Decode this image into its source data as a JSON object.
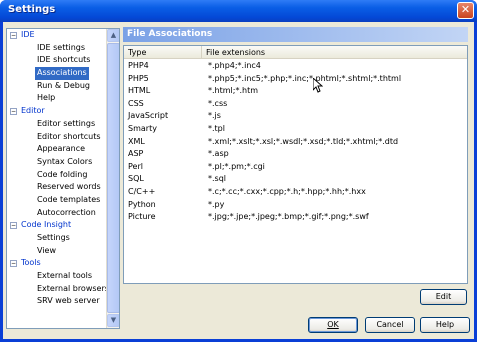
{
  "window": {
    "title": "Settings",
    "close_glyph": "✕"
  },
  "tree": {
    "rows": [
      {
        "kind": "cat",
        "label": "IDE",
        "expander": "−"
      },
      {
        "kind": "item",
        "label": "IDE settings"
      },
      {
        "kind": "item",
        "label": "IDE shortcuts"
      },
      {
        "kind": "item",
        "label": "Associations",
        "selected": true
      },
      {
        "kind": "item",
        "label": "Run & Debug"
      },
      {
        "kind": "item",
        "label": "Help"
      },
      {
        "kind": "cat",
        "label": "Editor",
        "expander": "−"
      },
      {
        "kind": "item",
        "label": "Editor settings"
      },
      {
        "kind": "item",
        "label": "Editor shortcuts"
      },
      {
        "kind": "item",
        "label": "Appearance"
      },
      {
        "kind": "item",
        "label": "Syntax Colors"
      },
      {
        "kind": "item",
        "label": "Code folding"
      },
      {
        "kind": "item",
        "label": "Reserved words"
      },
      {
        "kind": "item",
        "label": "Code templates"
      },
      {
        "kind": "item",
        "label": "Autocorrection"
      },
      {
        "kind": "cat",
        "label": "Code Insight",
        "expander": "−"
      },
      {
        "kind": "item",
        "label": "Settings"
      },
      {
        "kind": "item",
        "label": "View"
      },
      {
        "kind": "cat",
        "label": "Tools",
        "expander": "−"
      },
      {
        "kind": "item",
        "label": "External tools"
      },
      {
        "kind": "item",
        "label": "External browsers"
      },
      {
        "kind": "item",
        "label": "SRV web server"
      }
    ],
    "scroll_up_glyph": "▲",
    "scroll_down_glyph": "▼"
  },
  "panel": {
    "title": "File Associations",
    "columns": {
      "type": "Type",
      "ext": "File extensions"
    },
    "rows": [
      {
        "type": "PHP4",
        "ext": "*.php4;*.inc4"
      },
      {
        "type": "PHP5",
        "ext": "*.php5;*.inc5;*.php;*.inc;*.phtml;*.shtml;*.thtml"
      },
      {
        "type": "HTML",
        "ext": "*.html;*.htm"
      },
      {
        "type": "CSS",
        "ext": "*.css"
      },
      {
        "type": "JavaScript",
        "ext": "*.js"
      },
      {
        "type": "Smarty",
        "ext": "*.tpl"
      },
      {
        "type": "XML",
        "ext": "*.xml;*.xslt;*.xsl;*.wsdl;*.xsd;*.tld;*.xhtml;*.dtd"
      },
      {
        "type": "ASP",
        "ext": "*.asp"
      },
      {
        "type": "Perl",
        "ext": "*.pl;*.pm;*.cgi"
      },
      {
        "type": "SQL",
        "ext": "*.sql"
      },
      {
        "type": "C/C++",
        "ext": "*.c;*.cc;*.cxx;*.cpp;*.h;*.hpp;*.hh;*.hxx"
      },
      {
        "type": "Python",
        "ext": "*.py"
      },
      {
        "type": "Picture",
        "ext": "*.jpg;*.jpe;*.jpeg;*.bmp;*.gif;*.png;*.swf"
      }
    ]
  },
  "buttons": {
    "edit": "Edit",
    "ok": "OK",
    "cancel": "Cancel",
    "help": "Help"
  }
}
